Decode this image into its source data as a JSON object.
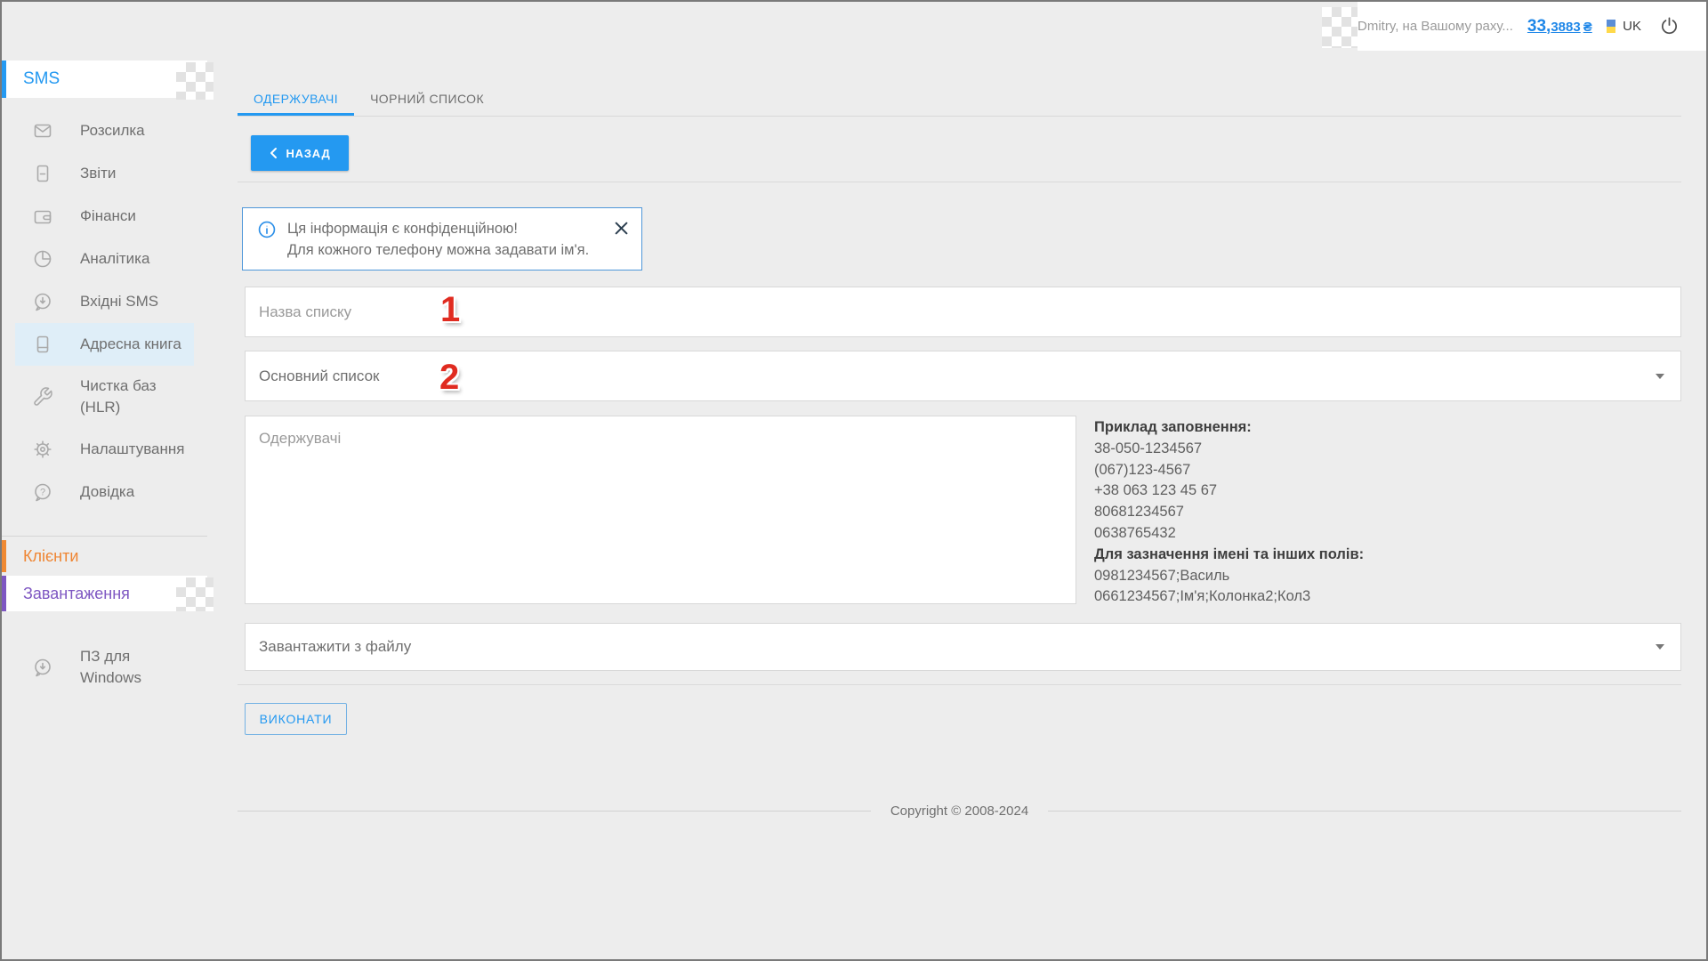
{
  "topbar": {
    "user_text": "Dmitry, на Вашому раху...",
    "balance_main": "33,",
    "balance_frac": "3883",
    "balance_currency": "₴",
    "lang": "UK"
  },
  "sidebar": {
    "section_title": "SMS",
    "items": [
      {
        "label": "Розсилка",
        "icon": "envelope-icon"
      },
      {
        "label": "Звіти",
        "icon": "report-icon"
      },
      {
        "label": "Фінанси",
        "icon": "wallet-icon"
      },
      {
        "label": "Аналітика",
        "icon": "pie-chart-icon"
      },
      {
        "label": "Вхідні SMS",
        "icon": "incoming-message-icon"
      },
      {
        "label": "Адресна книга",
        "icon": "address-book-icon",
        "active": true
      },
      {
        "label": "Чистка баз",
        "label2": "(HLR)",
        "icon": "wrench-icon"
      },
      {
        "label": "Налаштування",
        "icon": "gear-icon"
      },
      {
        "label": "Довідка",
        "icon": "help-icon"
      }
    ],
    "clients_label": "Клієнти",
    "downloads_label": "Завантаження",
    "windows_line1": "ПЗ для",
    "windows_line2": "Windows"
  },
  "tabs": {
    "recipients": "ОДЕРЖУВАЧІ",
    "blacklist": "ЧОРНИЙ СПИСОК"
  },
  "toolbar": {
    "back_label": "НАЗАД"
  },
  "info_box": {
    "line1": "Ця інформація є конфіденційною!",
    "line2": "Для кожного телефону можна задавати ім'я."
  },
  "form": {
    "annotation_1": "1",
    "annotation_2": "2",
    "list_name_placeholder": "Назва списку",
    "list_type_value": "Основний список",
    "recipients_placeholder": "Одержувачі",
    "upload_source_value": "Завантажити з файлу",
    "submit_label": "ВИКОНАТИ"
  },
  "example": {
    "title1": "Приклад заповнення:",
    "lines1": [
      "38-050-1234567",
      "(067)123-4567",
      "+38 063 123 45 67",
      "80681234567",
      "0638765432"
    ],
    "title2": "Для зазначення імені та інших полів:",
    "lines2": [
      "0981234567;Василь",
      "0661234567;Ім'я;Колонка2;Кол3"
    ]
  },
  "footer": {
    "copyright": "Copyright © 2008-2024"
  },
  "colors": {
    "accent_blue": "#2499f1",
    "orange": "#ef8532",
    "purple": "#7e57c2",
    "annotation_red": "#e02b20",
    "info_border": "#4e97d9",
    "active_item_bg": "#dfeef8"
  }
}
